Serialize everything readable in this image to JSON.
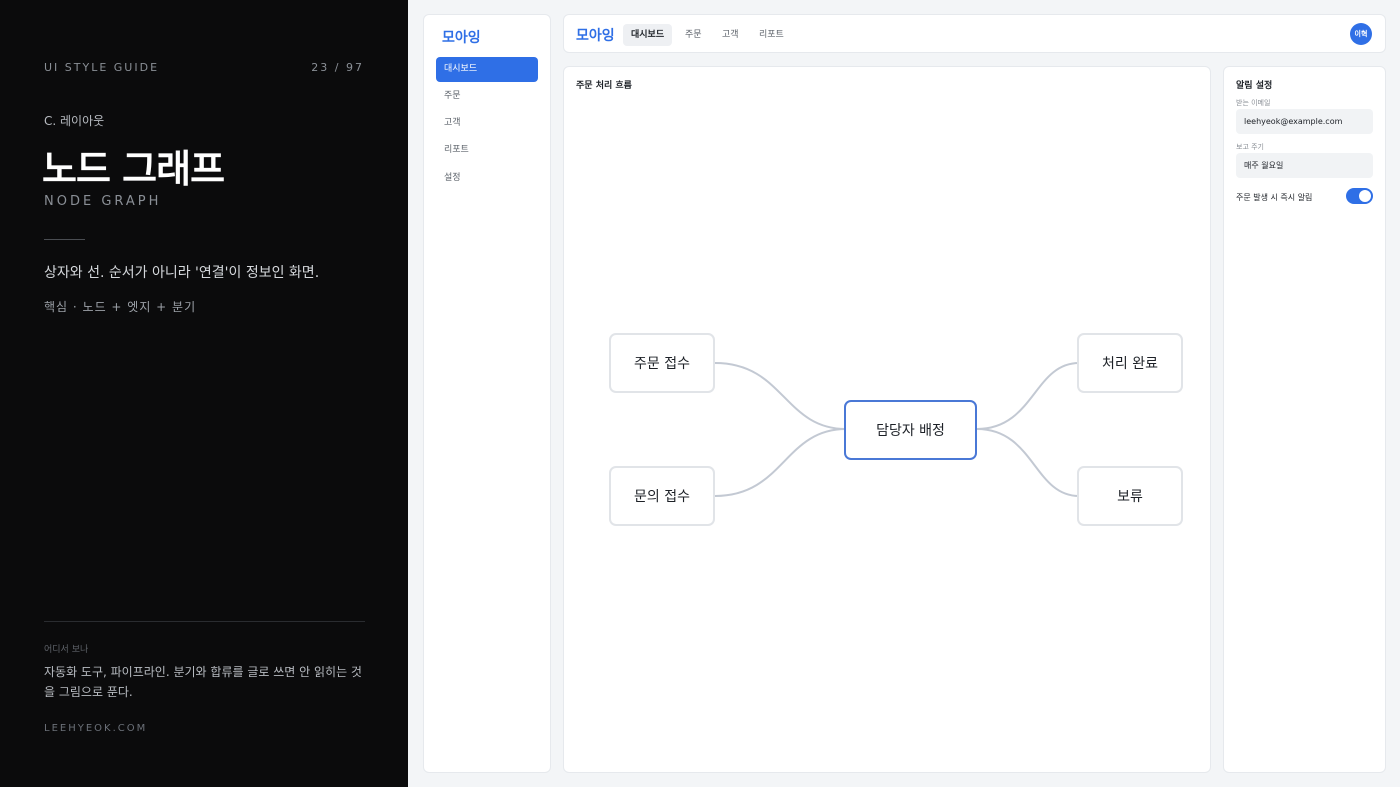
{
  "guide": {
    "kicker": "UI STYLE GUIDE",
    "pager": "23 / 97",
    "section": "C. 레이아웃",
    "title": "노드 그래프",
    "subtitle": "NODE GRAPH",
    "description": "상자와 선. 순서가 아니라 '연결'이 정보인 화면.",
    "keywords": "핵심 · 노드 + 엣지 + 분기",
    "where_label": "어디서 보나",
    "where_text": "자동화 도구, 파이프라인. 분기와 합류를 글로 쓰면 안 읽히는 것을 그림으로 푼다.",
    "site": "LEEHYEOK.COM"
  },
  "sidebar": {
    "brand": "모아잉",
    "items": [
      {
        "label": "대시보드",
        "active": true
      },
      {
        "label": "주문",
        "active": false
      },
      {
        "label": "고객",
        "active": false
      },
      {
        "label": "리포트",
        "active": false
      },
      {
        "label": "설정",
        "active": false
      }
    ]
  },
  "topbar": {
    "brand": "모아잉",
    "tabs": [
      {
        "label": "대시보드",
        "active": true
      },
      {
        "label": "주문",
        "active": false
      },
      {
        "label": "고객",
        "active": false
      },
      {
        "label": "리포트",
        "active": false
      }
    ],
    "avatar": "이혁"
  },
  "flow": {
    "title": "주문 처리 흐름",
    "nodes": {
      "order_received": "주문 접수",
      "inquiry_received": "문의 접수",
      "assign": "담당자 배정",
      "complete": "처리 완료",
      "hold": "보류"
    }
  },
  "settings": {
    "title": "알림 설정",
    "email_label": "받는 이메일",
    "email_value": "leehyeok@example.com",
    "cycle_label": "보고 주기",
    "cycle_value": "매주 월요일",
    "instant_label": "주문 발생 시 즉시 알림",
    "instant_on": true
  },
  "colors": {
    "accent": "#2f6fe6",
    "dark_panel": "#0b0b0c",
    "edge": "#c3c9d3",
    "center_border": "#4a78d6"
  }
}
